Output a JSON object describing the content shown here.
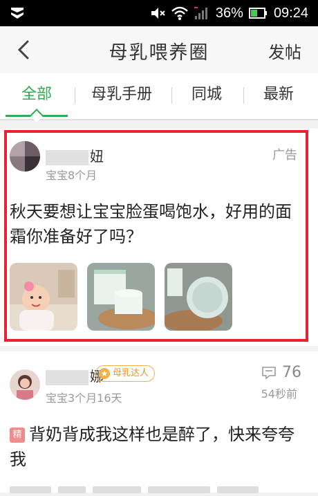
{
  "status_bar": {
    "battery": "36%",
    "time": "09:24"
  },
  "title_bar": {
    "title": "母乳喂养圈",
    "post_label": "发帖"
  },
  "tabs": [
    {
      "label": "全部",
      "active": true
    },
    {
      "label": "母乳手册",
      "active": false
    },
    {
      "label": "同城",
      "active": false
    },
    {
      "label": "最新",
      "active": false
    }
  ],
  "posts": [
    {
      "username": "妞",
      "baby_age": "宝宝8个月",
      "ad_tag": "广告",
      "title": "秋天要想让宝宝脸蛋喝饱水，好用的面霜你准备好了吗？",
      "images": [
        "baby-photo",
        "cream-jar-photo",
        "cream-lid-photo"
      ]
    },
    {
      "username": "娜",
      "badge": "母乳达人",
      "baby_age": "宝宝3个月16天",
      "comment_count": "76",
      "time_ago": "54秒前",
      "tag": "精",
      "title": "背奶背成我这样也是醉了，快来夸夸我"
    }
  ],
  "colors": {
    "accent_green": "#2eab4e",
    "ad_highlight_red": "#e8222e",
    "badge_orange": "#f0b04a"
  }
}
